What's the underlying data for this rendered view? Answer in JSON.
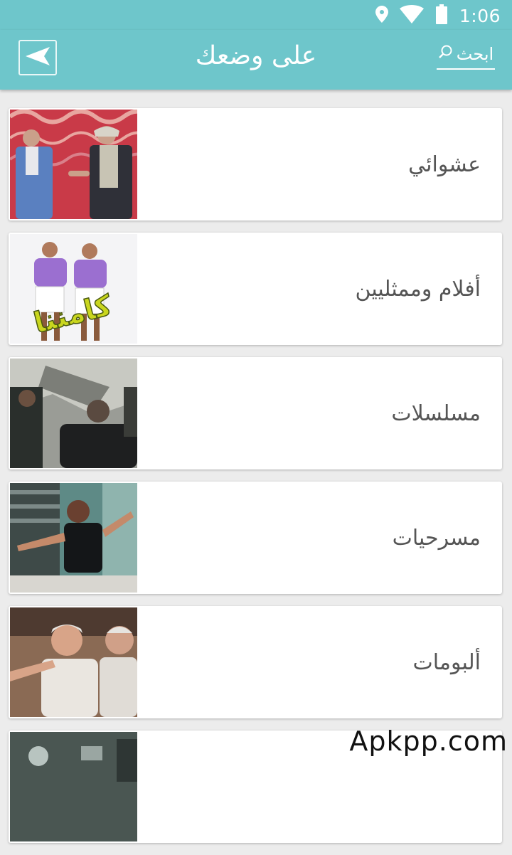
{
  "status_bar": {
    "time": "1:06",
    "icons": [
      "location-icon",
      "wifi-icon",
      "battery-icon"
    ]
  },
  "app_bar": {
    "title": "على وضعك",
    "search_label": "ابحث",
    "back_icon": "back-arrow-icon"
  },
  "categories": [
    {
      "label": "عشوائي"
    },
    {
      "label": "أفلام وممثليين"
    },
    {
      "label": "مسلسلات"
    },
    {
      "label": "مسرحيات"
    },
    {
      "label": "ألبومات"
    },
    {
      "label": ""
    }
  ],
  "thumbnail_text": {
    "kamanna": "كامننا"
  },
  "watermark": "Apkpp.com",
  "colors": {
    "accent": "#6ec6cb",
    "card": "#ffffff",
    "background": "#ececec",
    "label": "#555555"
  }
}
